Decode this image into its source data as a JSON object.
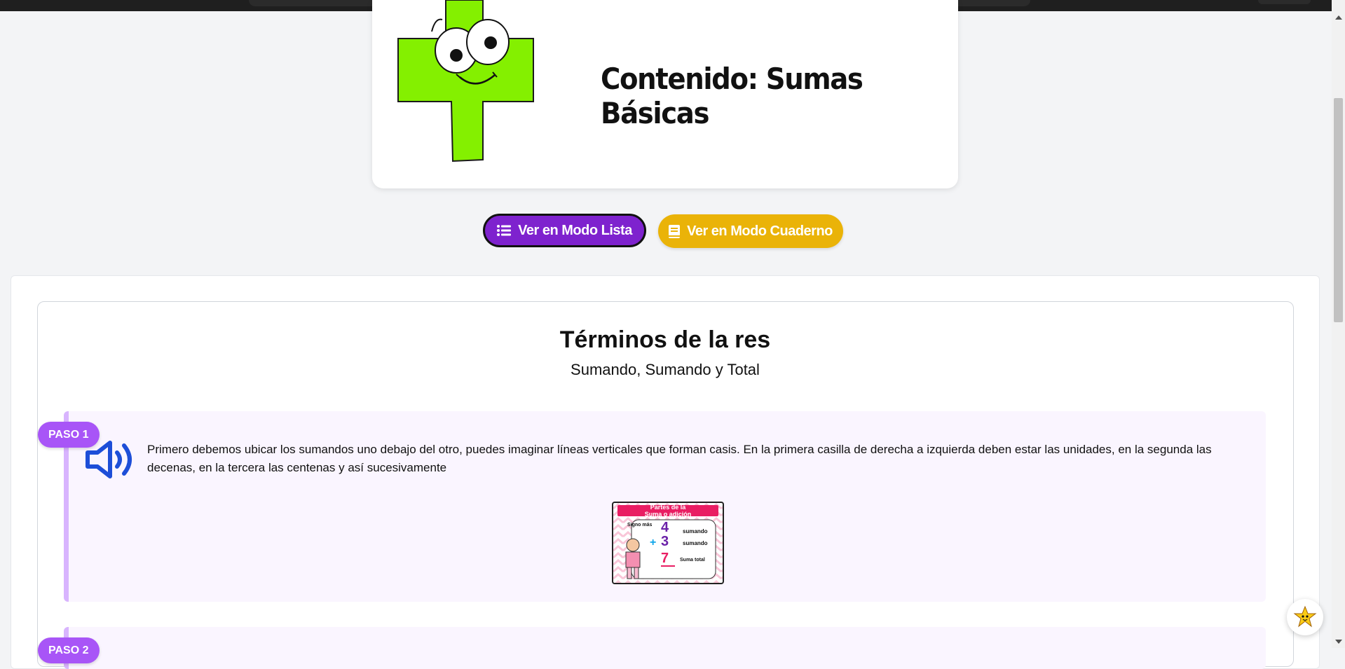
{
  "header": {
    "title": "Contenido: Sumas Básicas"
  },
  "view_buttons": {
    "list_label": "Ver en Modo Lista",
    "notebook_label": "Ver en Modo Cuaderno"
  },
  "section": {
    "title": "Términos de la res",
    "subtitle": "Sumando, Sumando y Total"
  },
  "steps": [
    {
      "badge": "PASO 1",
      "text": "Primero debemos ubicar los sumandos uno debajo del otro, puedes imaginar líneas verticales que forman casis. En la primera casilla de derecha a izquierda deben estar las unidades, en la segunda las decenas, en la tercera las centenas y así sucesivamente",
      "image": {
        "title_line1": "Partes de la",
        "title_line2": "Suma o adición",
        "sign_label": "Signo más",
        "num1": "4",
        "num2": "3",
        "result": "7",
        "label1": "sumando",
        "label2": "sumando",
        "label3": "Suma total"
      }
    },
    {
      "badge": "PASO 2"
    }
  ],
  "icons": {
    "list": "list-icon",
    "notebook": "book-icon",
    "speaker": "speaker-icon",
    "assistant": "star-mascot-icon"
  },
  "colors": {
    "primary_purple": "#7e22ce",
    "notebook_yellow": "#eab308",
    "badge_purple": "#a855f7",
    "mascot_green": "#84f000"
  }
}
